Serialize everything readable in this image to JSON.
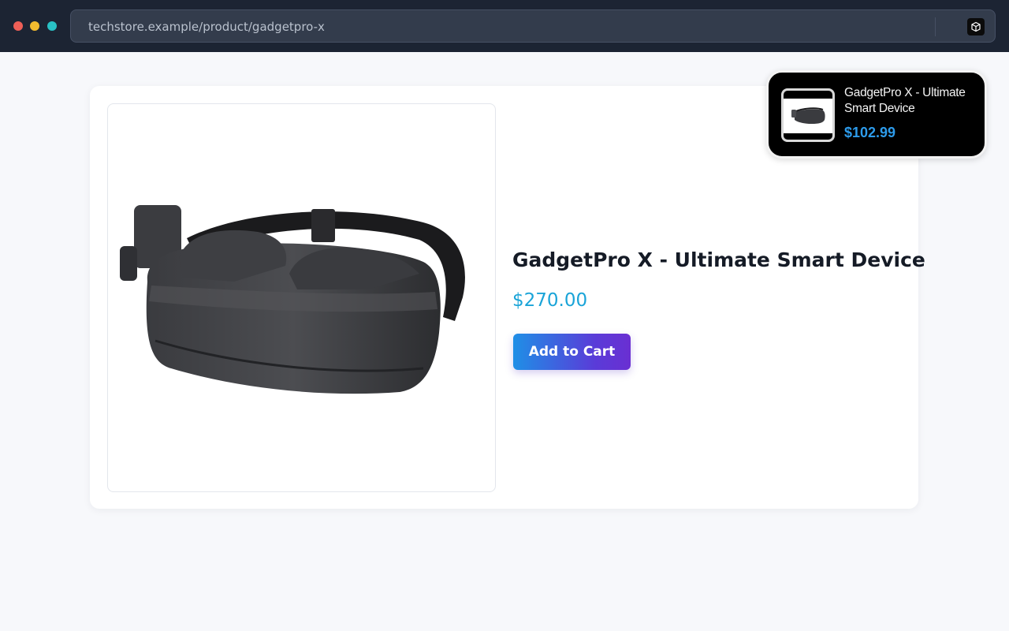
{
  "browser": {
    "url": "techstore.example/product/gadgetpro-x",
    "extension_icon": "cube-icon"
  },
  "product": {
    "image_icon": "vr-headset-image",
    "title": "GadgetPro X - Ultimate Smart Device",
    "price": "$270.00",
    "add_to_cart_label": "Add to Cart"
  },
  "popup": {
    "title": "GadgetPro X - Ultimate Smart Device",
    "price": "$102.99"
  },
  "colors": {
    "chrome_bg": "#1c2433",
    "price": "#1aa4d8",
    "button_gradient_start": "#1f8fe6",
    "button_gradient_end": "#6a2fd2",
    "popup_price": "#2d9bea"
  }
}
